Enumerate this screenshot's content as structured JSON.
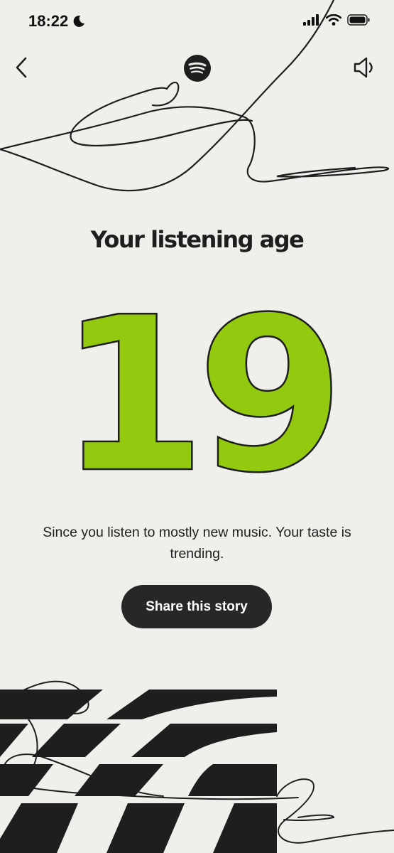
{
  "status_bar": {
    "time": "18:22",
    "icons": [
      "moon-icon",
      "cellular-signal-icon",
      "wifi-icon",
      "battery-icon"
    ]
  },
  "nav": {
    "back_icon": "chevron-left-icon",
    "logo_icon": "spotify-logo-icon",
    "sound_icon": "speaker-icon"
  },
  "story": {
    "headline": "Your listening age",
    "age": "19",
    "description": "Since you listen to mostly new music. Your taste is trending.",
    "share_label": "Share this story"
  },
  "colors": {
    "background": "#efefeb",
    "accent_green": "#93c90f",
    "ink": "#1e1e1e",
    "button": "#272727"
  }
}
